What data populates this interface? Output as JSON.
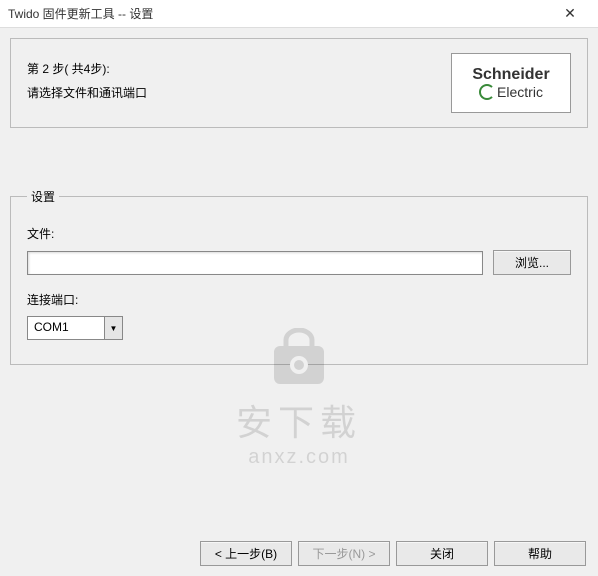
{
  "window": {
    "title": "Twido 固件更新工具 -- 设置"
  },
  "panel": {
    "step_line": "第 2 步( 共4步):",
    "instruction": "请选择文件和通讯端口"
  },
  "logo": {
    "line1": "Schneider",
    "line2": "Electric"
  },
  "settings": {
    "legend": "设置",
    "file_label": "文件:",
    "file_value": "",
    "browse_label": "浏览...",
    "port_label": "连接端口:",
    "port_value": "COM1"
  },
  "footer": {
    "back": "< 上一步(B)",
    "next": "下一步(N) >",
    "close": "关闭",
    "help": "帮助"
  },
  "watermark": {
    "line1": "安下载",
    "line2": "anxz.com"
  }
}
